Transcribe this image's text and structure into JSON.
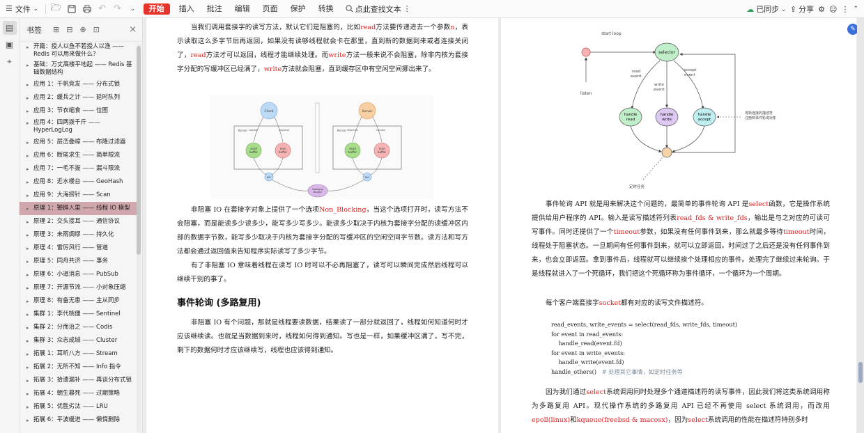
{
  "toolbar": {
    "file_label": "文件",
    "tabs": [
      {
        "label": "开始",
        "active": true
      },
      {
        "label": "插入"
      },
      {
        "label": "批注"
      },
      {
        "label": "编辑"
      },
      {
        "label": "页面"
      },
      {
        "label": "保护"
      },
      {
        "label": "转换"
      }
    ],
    "search_label": "点此查找文本",
    "sync_label": "已同步",
    "share_label": "分享"
  },
  "bookmarks": {
    "title": "书签",
    "items": [
      {
        "label": "开篇：授人以鱼不若授人以渔 —— Redis 可以用来做什么？"
      },
      {
        "label": "基础：万丈高楼平地起 —— Redis 基础数据结构"
      },
      {
        "label": "应用 1：千帆竞发 —— 分布式锁"
      },
      {
        "label": "应用 2：缓兵之计 —— 延时队列"
      },
      {
        "label": "应用 3：节衣缩食 —— 位图"
      },
      {
        "label": "应用 4：四两拨千斤 —— HyperLogLog"
      },
      {
        "label": "应用 5：层峦叠嶂 —— 布隆过滤器"
      },
      {
        "label": "应用 6：断尾求生 —— 简单限流"
      },
      {
        "label": "应用 7：一毛不拔 —— 漏斗限流"
      },
      {
        "label": "应用 8：近水楼台 —— GeoHash"
      },
      {
        "label": "应用 9：大海捞针 —— Scan"
      },
      {
        "label": "原理 1：鞭辟入里 —— 线程 IO 模型",
        "selected": true
      },
      {
        "label": "原理 2：交头接耳 —— 通信协议"
      },
      {
        "label": "原理 3：未雨绸缪 —— 持久化"
      },
      {
        "label": "原理 4：雷厉风行 —— 管道"
      },
      {
        "label": "原理 5：同舟共济 —— 事务"
      },
      {
        "label": "原理 6：小道消息 —— PubSub"
      },
      {
        "label": "原理 7：开源节流 —— 小对象压缩"
      },
      {
        "label": "原理 8：有备无患 —— 主从同步"
      },
      {
        "label": "集群 1：李代桃僵 —— Sentinel"
      },
      {
        "label": "集群 2：分而治之 —— Codis"
      },
      {
        "label": "集群 3：众志成城 —— Cluster"
      },
      {
        "label": "拓展 1：耳听八方 —— Stream"
      },
      {
        "label": "拓展 2：无所不知 —— Info 指令"
      },
      {
        "label": "拓展 3：拾遗漏补 —— 再谈分布式锁"
      },
      {
        "label": "拓展 4：朝生暮死 —— 过期策略"
      },
      {
        "label": "拓展 5：优胜劣汰 —— LRU"
      },
      {
        "label": "拓展 6：平波缓进 —— 懒惰删除"
      }
    ]
  },
  "page1": {
    "para1_a": "当我们调用套接字的读写方法，默认它们是阻塞的，比如",
    "para1_read": "read",
    "para1_b": "方法要传递进去一个参数",
    "para1_n": "n",
    "para1_c": "，表示读取这么多字节后再返回，如果没有读够线程就会卡在那里，直到新的数据到来或者连接关闭了，",
    "para1_read2": "read",
    "para1_d": "方法才可以返回，线程才能继续处理。而",
    "para1_write": "write",
    "para1_e": "方法一般来说不会阻塞，除非内核为套接字分配的写缓冲区已经满了，",
    "para1_write2": "write",
    "para1_f": "方法就会阻塞，直到缓存区中有空闲空间挪出来了。",
    "diagram": {
      "client": "Client",
      "server": "Server",
      "kernel": "Kernel",
      "request": "request",
      "response": "response",
      "send": "send",
      "recv": "recv",
      "buffer": "buffer",
      "nic": "NIC",
      "gateway": "Gateway",
      "router": "Router"
    },
    "para2_a": "非阻塞 IO 在套接字对象上提供了一个选项",
    "para2_nb": "Non_Blocking",
    "para2_b": "，当这个选项打开时，读写方法不会阻塞，而是能读多少读多少，能写多少写多少。能读多少取决于内核为套接字分配的读缓冲区内部的数据字节数，能写多少取决于内核为套接字分配的写缓冲区的空闲空间字节数。读方法和写方法都会通过返回值来告知程序实际读写了多少字节。",
    "para3": "有了非阻塞 IO 意味着线程在读写 IO 时可以不必再阻塞了，读写可以瞬间完成然后线程可以继续干别的事了。",
    "heading": "事件轮询 (多路复用)",
    "para4": "非阻塞 IO 有个问题，那就是线程要读数据，结果读了一部分就返回了，线程如何知道何时才应该继续读。也就是当数据到来时，线程如何得到通知。写也是一样，如果缓冲区满了，写不完，剩下的数据何时才应该继续写，线程也应该得到通知。"
  },
  "page2": {
    "diagram": {
      "start_loop": "start loop",
      "selector": "selector",
      "read_event": "read\nevent",
      "write_event": "write\nevent",
      "accept_event": "accept\nevent",
      "listen": "listen",
      "handle_read": "handle\nread",
      "handle_write": "handle\nwrite",
      "handle_accept": "handle\naccept",
      "note": "将新连接的描述符\n注册到事件轮询对象",
      "timer": "定时任务"
    },
    "p1_a": "事件轮询 API 就是用来解决这个问题的，最简单的事件轮询 API 是",
    "p1_select": "select",
    "p1_b": "函数，它是操作系统提供给用户程序的 API。输入是读写描述符列表",
    "p1_fds": "read_fds & write_fds",
    "p1_c": "，输出是与之对应的可读可写事件。同时还提供了一个",
    "p1_timeout": "timeout",
    "p1_d": "参数，如果没有任何事件到来，那么就最多等待",
    "p1_timeout2": "timeout",
    "p1_e": "时间，线程处于阻塞状态。一旦期间有任何事件到来，就可以立即返回。时间过了之后还是没有任何事件到来，也会立即返回。拿到事件后，线程就可以继续挨个处理相应的事件。处理完了继续过来轮询。于是线程就进入了一个死循环，我们把这个死循环称为事件循环，一个循环为一个周期。",
    "p2_a": "每个客户端套接字",
    "p2_socket": "socket",
    "p2_b": "都有对应的读写文件描述符。",
    "code_lines": [
      "read_events, write_events = select(read_fds, write_fds, timeout)",
      "for event in read_events:",
      "    handle_read(event.fd)",
      "for event in write_events:",
      "    handle_write(event.fd)",
      "handle_others()"
    ],
    "code_comment": "# 处理其它事情，如定时任务等",
    "p3_a": "因为我们通过",
    "p3_select": "select",
    "p3_b": "系统调用同时处理多个通道描述符的读写事件，因此我们将这类系统调用称为多路复用 API。现代操作系统的多路复用 API 已经不再使用 select 系统调用，而改用",
    "p3_epoll": "epoll(linux)",
    "p3_c": "和",
    "p3_kqueue": "kqueue(freebsd & macosx)",
    "p3_d": "，因为",
    "p3_select2": "select",
    "p3_e": "系统调用的性能在描述符特别多时"
  },
  "icons": {
    "menu": "menu-icon",
    "open": "folder-icon",
    "save": "save-icon",
    "print": "print-icon",
    "undo": "undo-icon",
    "redo": "redo-icon",
    "search": "search-icon"
  },
  "colors": {
    "accent": "#e8332b",
    "keyword": "#e02020",
    "selected_bookmark": "#cfa7ac"
  }
}
